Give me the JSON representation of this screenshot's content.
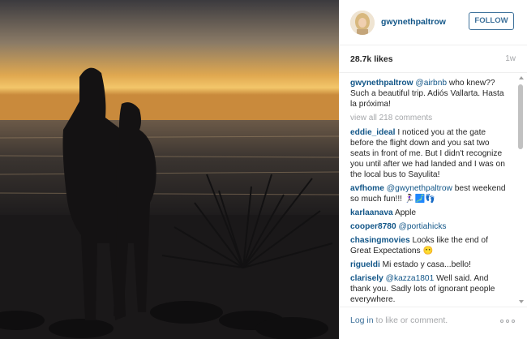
{
  "header": {
    "username": "gwynethpaltrow",
    "follow_label": "FOLLOW"
  },
  "stats": {
    "likes": "28.7k likes",
    "age": "1w"
  },
  "caption": {
    "user": "gwynethpaltrow",
    "mention": "@airbnb",
    "text": " who knew?? Such a beautiful trip. Adiós Vallarta. Hasta la próxima!"
  },
  "view_all": "view all 218 comments",
  "comments": [
    {
      "user": "eddie_ideal",
      "mention": "",
      "text": "I noticed you at the gate before the flight down and you sat two seats in front of me. But I didn't recognize you until after we had landed and I was on the local bus to Sayulita!"
    },
    {
      "user": "avfhome",
      "mention": "@gwynethpaltrow",
      "text": " best weekend so much fun!!! 🏃🏻‍♀️🗾👣"
    },
    {
      "user": "karlaanava",
      "mention": "",
      "text": "Apple"
    },
    {
      "user": "cooper8780",
      "mention": "@portiahicks",
      "text": ""
    },
    {
      "user": "chasingmovies",
      "mention": "",
      "text": "Looks like the end of Great Expectations 😶"
    },
    {
      "user": "rigueldi",
      "mention": "",
      "text": "Mi estado y casa...bello!"
    },
    {
      "user": "clarisely",
      "mention": "@kazza1801",
      "text": " Well said. And thank you. Sadly lots of ignorant people everywhere."
    }
  ],
  "footer": {
    "login_label": "Log in",
    "rest_label": " to like or comment."
  },
  "colors": {
    "link_blue": "#125688",
    "button_blue": "#3f729b",
    "muted_gray": "#a5a7aa"
  },
  "icons": {
    "more": "more-options-icon"
  }
}
